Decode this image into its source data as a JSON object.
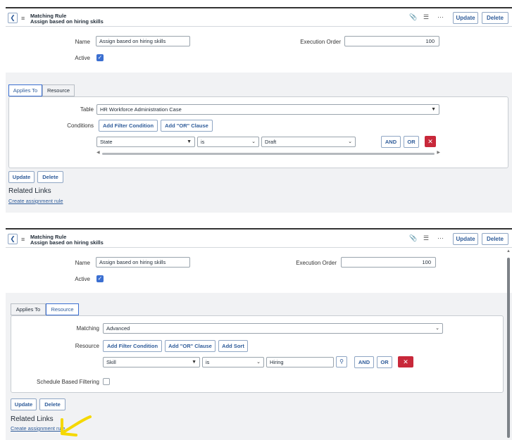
{
  "header": {
    "title_line1": "Matching Rule",
    "title_line2": "Assign based on hiring skills",
    "back_icon": "chevron-left-icon",
    "menu_icon": "hamburger-icon",
    "attachment_icon": "paperclip-icon",
    "settings_icon": "sliders-icon",
    "more_icon": "ellipsis-icon",
    "update_label": "Update",
    "delete_label": "Delete"
  },
  "form": {
    "name_label": "Name",
    "name_value": "Assign based on hiring skills",
    "execution_order_label": "Execution Order",
    "execution_order_value": "100",
    "active_label": "Active",
    "active_checked": true
  },
  "tabs": {
    "applies_to": "Applies To",
    "resource": "Resource"
  },
  "applies_to_panel": {
    "table_label": "Table",
    "table_value": "HR Workforce Administration Case",
    "conditions_label": "Conditions",
    "add_filter_label": "Add Filter Condition",
    "add_or_label": "Add \"OR\" Clause",
    "condition_field": "State",
    "condition_operator": "is",
    "condition_value": "Draft",
    "and_label": "AND",
    "or_label": "OR",
    "remove_icon": "close-icon"
  },
  "resource_panel": {
    "matching_label": "Matching",
    "matching_value": "Advanced",
    "resource_label": "Resource",
    "add_filter_label": "Add Filter Condition",
    "add_or_label": "Add \"OR\" Clause",
    "add_sort_label": "Add Sort",
    "condition_field": "Skill",
    "condition_operator": "is",
    "condition_value": "Hiring",
    "lookup_icon": "search-icon",
    "and_label": "AND",
    "or_label": "OR",
    "remove_icon": "close-icon",
    "schedule_label": "Schedule Based Filtering",
    "schedule_checked": false
  },
  "footer": {
    "update_label": "Update",
    "delete_label": "Delete",
    "related_links_title": "Related Links",
    "create_assignment_rule": "Create assignment rule"
  },
  "annotation": {
    "arrow_color": "#f5d800"
  },
  "colors": {
    "accent": "#3b6fd1",
    "link": "#2f5c9a",
    "danger": "#c8283a",
    "band": "#f1f2f4"
  }
}
